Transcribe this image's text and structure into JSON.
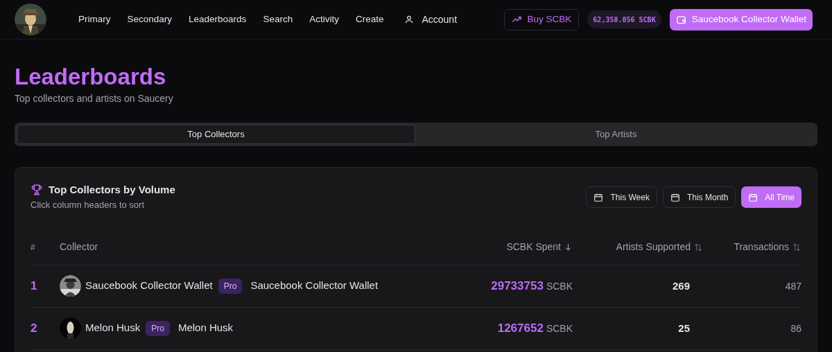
{
  "nav": {
    "links": [
      "Primary",
      "Secondary",
      "Leaderboards",
      "Search",
      "Activity",
      "Create"
    ],
    "account": "Account",
    "buy": "Buy SCBK",
    "balance": "62,358.056 SCBK",
    "wallet": "Saucebook Collector Wallet"
  },
  "page": {
    "title": "Leaderboards",
    "subtitle": "Top collectors and artists on Saucery"
  },
  "tabs": [
    {
      "label": "Top Collectors",
      "selected": true
    },
    {
      "label": "Top Artists",
      "selected": false
    }
  ],
  "card": {
    "title": "Top Collectors by Volume",
    "subtitle": "Click column headers to sort",
    "periods": [
      {
        "label": "This Week",
        "selected": false
      },
      {
        "label": "This Month",
        "selected": false
      },
      {
        "label": "All Time",
        "selected": true
      }
    ]
  },
  "table": {
    "columns": [
      {
        "label": "#"
      },
      {
        "label": "Collector"
      },
      {
        "label": "SCBK Spent",
        "sorted": true
      },
      {
        "label": "Artists Supported",
        "sorted": false
      },
      {
        "label": "Transactions",
        "sorted": false
      }
    ],
    "rows": [
      {
        "rank": "1",
        "name": "Saucebook Collector Wallet",
        "badge": "Pro",
        "display_name": "Saucebook Collector Wallet",
        "spent": "29733753",
        "unit": "SCBK",
        "artists": "269",
        "transactions": "487"
      },
      {
        "rank": "2",
        "name": "Melon Husk",
        "badge": "Pro",
        "display_name": "Melon Husk",
        "spent": "1267652",
        "unit": "SCBK",
        "artists": "25",
        "transactions": "86"
      }
    ]
  }
}
